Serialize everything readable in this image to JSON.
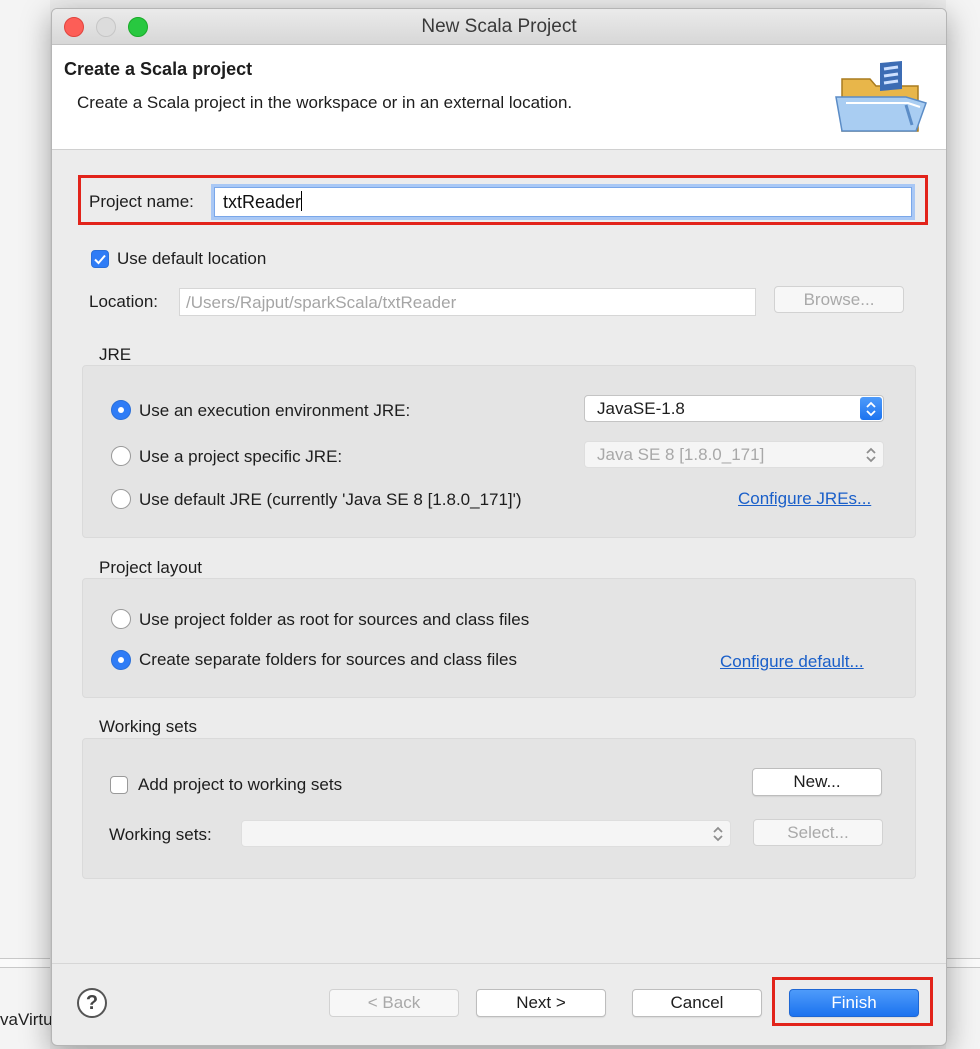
{
  "background": {
    "partial_text": "vaVirtu"
  },
  "window": {
    "title": "New Scala Project"
  },
  "header": {
    "title": "Create a Scala project",
    "description": "Create a Scala project in the workspace or in an external location."
  },
  "project_name": {
    "label": "Project name:",
    "value": "txtReader"
  },
  "location": {
    "use_default_label": "Use default location",
    "use_default_checked": true,
    "label": "Location:",
    "value": "/Users/Rajput/sparkScala/txtReader",
    "browse_label": "Browse..."
  },
  "jre": {
    "group_title": "JRE",
    "options": [
      {
        "label": "Use an execution environment JRE:",
        "selected": true
      },
      {
        "label": "Use a project specific JRE:",
        "selected": false
      },
      {
        "label": "Use default JRE (currently 'Java SE 8 [1.8.0_171]')",
        "selected": false
      }
    ],
    "env_select_value": "JavaSE-1.8",
    "specific_select_value": "Java SE 8 [1.8.0_171]",
    "configure_link": "Configure JREs..."
  },
  "project_layout": {
    "group_title": "Project layout",
    "options": [
      {
        "label": "Use project folder as root for sources and class files",
        "selected": false
      },
      {
        "label": "Create separate folders for sources and class files",
        "selected": true
      }
    ],
    "configure_link": "Configure default..."
  },
  "working_sets": {
    "group_title": "Working sets",
    "add_label": "Add project to working sets",
    "add_checked": false,
    "new_button": "New...",
    "sets_label": "Working sets:",
    "sets_value": "",
    "select_button": "Select..."
  },
  "footer": {
    "back_label": "< Back",
    "next_label": "Next >",
    "cancel_label": "Cancel",
    "finish_label": "Finish",
    "help_glyph": "?"
  },
  "colors": {
    "accent": "#2f7cf6",
    "highlight_box": "#e2231a",
    "link": "#1a5fc9"
  }
}
